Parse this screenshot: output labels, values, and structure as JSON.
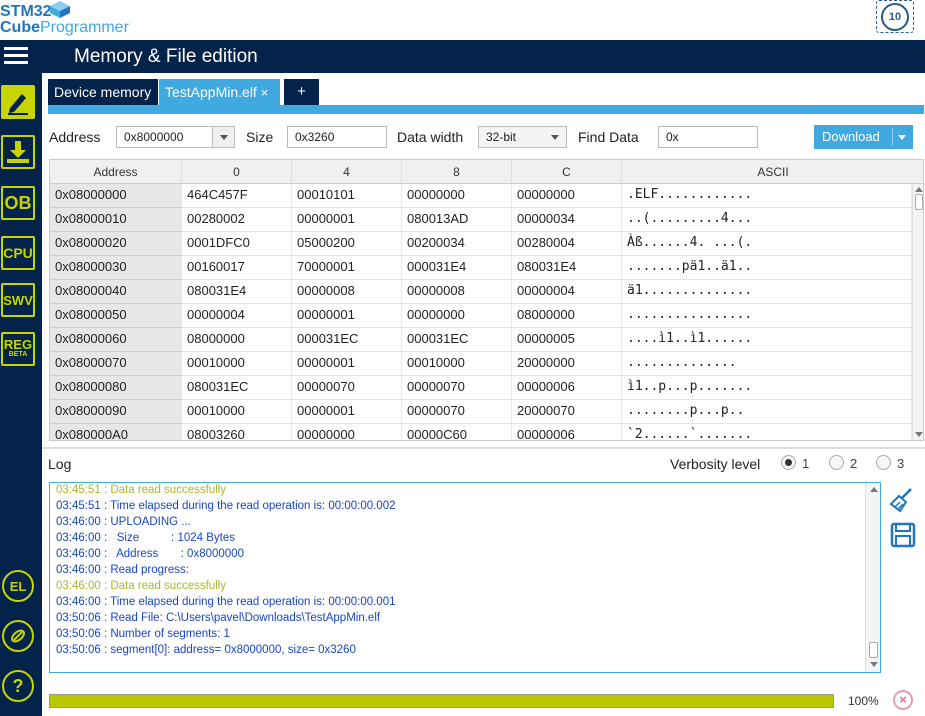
{
  "app": {
    "logo_line1": "STM32",
    "logo_cube": "Cube",
    "logo_prog": "Programmer",
    "badge_text": "10"
  },
  "header": {
    "title": "Memory & File edition"
  },
  "sidebar": {
    "items": [
      {
        "label": "",
        "icon": "edit-icon"
      },
      {
        "label": "",
        "icon": "download-icon"
      },
      {
        "label": "OB",
        "icon": "option-bytes-icon"
      },
      {
        "label": "CPU",
        "icon": "cpu-icon"
      },
      {
        "label": "SWV",
        "icon": "swv-icon"
      },
      {
        "label": "REG",
        "sub": "BETA",
        "icon": "registers-icon"
      }
    ],
    "bottom": [
      {
        "label": "EL",
        "icon": "external-loader-icon"
      },
      {
        "label": "",
        "icon": "security-icon"
      },
      {
        "label": "?",
        "icon": "help-icon"
      }
    ]
  },
  "tabs": [
    {
      "label": "Device memory"
    },
    {
      "label": "TestAppMin.elf",
      "close": "×"
    },
    {
      "label": "+"
    }
  ],
  "toolbar": {
    "address_label": "Address",
    "address_value": "0x8000000",
    "size_label": "Size",
    "size_value": "0x3260",
    "width_label": "Data width",
    "width_value": "32-bit",
    "find_label": "Find Data",
    "find_value": "0x",
    "download_label": "Download"
  },
  "table": {
    "headers": [
      "Address",
      "0",
      "4",
      "8",
      "C",
      "ASCII"
    ],
    "rows": [
      [
        "0x08000000",
        "464C457F",
        "00010101",
        "00000000",
        "00000000",
        ".ELF............"
      ],
      [
        "0x08000010",
        "00280002",
        "00000001",
        "080013AD",
        "00000034",
        "..(.........4..."
      ],
      [
        "0x08000020",
        "0001DFC0",
        "05000200",
        "00200034",
        "00280004",
        "Àß......4. ...(."
      ],
      [
        "0x08000030",
        "00160017",
        "70000001",
        "000031E4",
        "080031E4",
        ".......pä1..ä1.."
      ],
      [
        "0x08000040",
        "080031E4",
        "00000008",
        "00000008",
        "00000004",
        "ä1.............."
      ],
      [
        "0x08000050",
        "00000004",
        "00000001",
        "00000000",
        "08000000",
        "................"
      ],
      [
        "0x08000060",
        "08000000",
        "000031EC",
        "000031EC",
        "00000005",
        "....ì1..ì1......"
      ],
      [
        "0x08000070",
        "00010000",
        "00000001",
        "00010000",
        "20000000",
        "..............  "
      ],
      [
        "0x08000080",
        "080031EC",
        "00000070",
        "00000070",
        "00000006",
        "ì1..p...p......."
      ],
      [
        "0x08000090",
        "00010000",
        "00000001",
        "00000070",
        "20000070",
        "........p...p.. "
      ],
      [
        "0x080000A0",
        "08003260",
        "00000000",
        "00000C60",
        "00000006",
        "`2......`......."
      ]
    ]
  },
  "log": {
    "title": "Log",
    "verbosity_label": "Verbosity level",
    "levels": [
      "1",
      "2",
      "3"
    ],
    "selected_level": "1",
    "lines": [
      {
        "text": "03:45:51 : Data read successfully",
        "color": "green"
      },
      {
        "text": "03:45:51 : Time elapsed during the read operation is: 00:00:00.002",
        "color": "blue"
      },
      {
        "text": "03:46:00 : UPLOADING ...",
        "color": "blue"
      },
      {
        "text": "03:46:00 :   Size          : 1024 Bytes",
        "color": "blue"
      },
      {
        "text": "03:46:00 :   Address       : 0x8000000",
        "color": "blue"
      },
      {
        "text": "03:46:00 : Read progress:",
        "color": "blue"
      },
      {
        "text": "03:46:00 : Data read successfully",
        "color": "green"
      },
      {
        "text": "03:46:00 : Time elapsed during the read operation is: 00:00:00.001",
        "color": "blue"
      },
      {
        "text": "03:50:06 : Read File: C:\\Users\\pavel\\Downloads\\TestAppMin.elf",
        "color": "blue"
      },
      {
        "text": "03:50:06 : Number of segments: 1",
        "color": "blue"
      },
      {
        "text": "03:50:06 : segment[0]: address= 0x8000000, size= 0x3260",
        "color": "blue"
      }
    ]
  },
  "progress": {
    "percent_text": "100%",
    "value": 1.0
  },
  "colors": {
    "navy": "#03234b",
    "accent": "#3fa9e0",
    "lime": "#c6d500"
  }
}
